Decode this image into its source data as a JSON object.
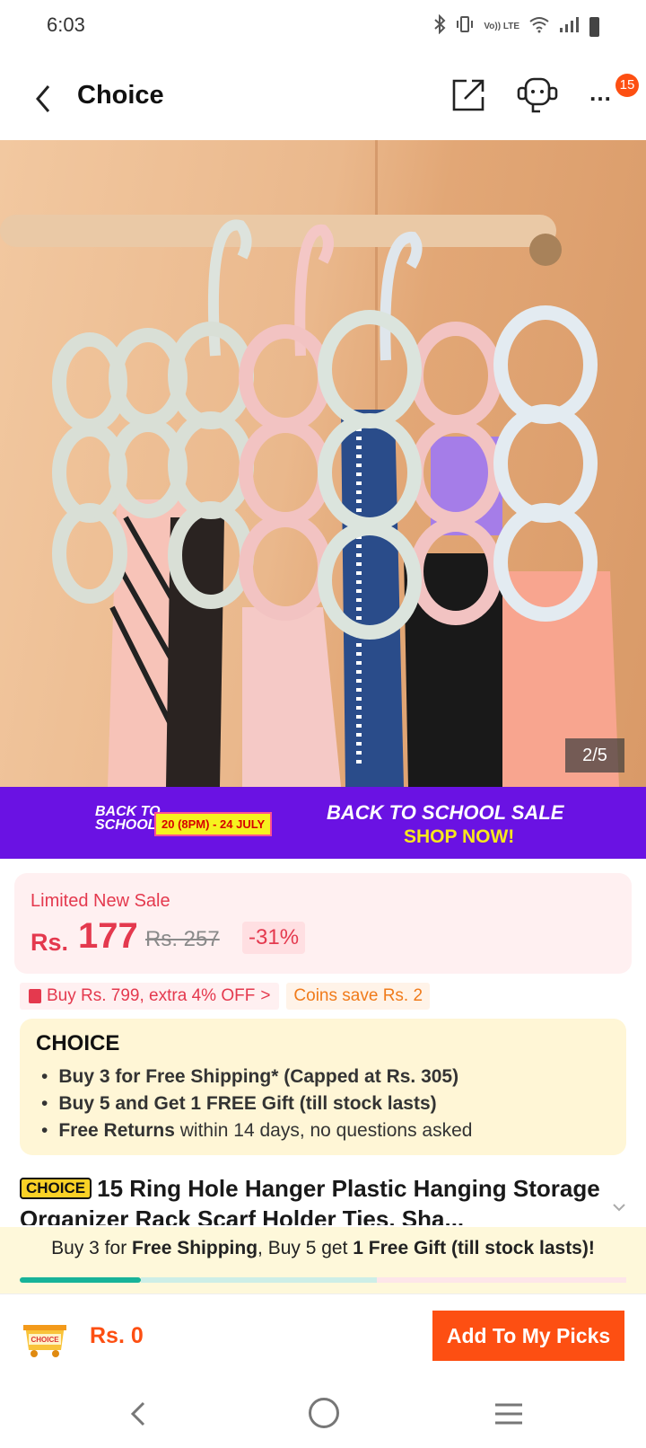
{
  "status_bar": {
    "time": "6:03",
    "icons": [
      "bluetooth-icon",
      "vibrate-icon",
      "volte-icon",
      "wifi-icon",
      "signal-icon",
      "battery-icon"
    ],
    "volte_label": "Vo)) LTE"
  },
  "header": {
    "title": "Choice",
    "more_badge": "15",
    "more_glyph": "…"
  },
  "gallery": {
    "counter": "2/5"
  },
  "promo": {
    "logo_line1": "BACK TO",
    "logo_line2": "SCHOOL",
    "dates": "20 (8PM) - 24 JULY",
    "title": "BACK TO SCHOOL SALE",
    "cta": "SHOP NOW!",
    "colors": {
      "background": "#6a12e3",
      "accent": "#f8e81c"
    }
  },
  "price": {
    "label": "Limited New Sale",
    "currency": "Rs.",
    "current": "177",
    "original": "Rs. 257",
    "discount": "-31%"
  },
  "coupons": {
    "coupon": "Buy Rs. 799, extra 4% OFF",
    "coupon_chevron": ">",
    "coins": "Coins save Rs. 2"
  },
  "choice": {
    "logo": "CHOICE",
    "items": [
      {
        "bold": "Buy 3 for  Free Shipping* (Capped at Rs. 305)",
        "rest": ""
      },
      {
        "bold": "Buy 5 and Get 1 FREE Gift (till stock lasts)",
        "rest": ""
      },
      {
        "bold": "Free Returns",
        "rest": " within 14 days, no questions asked"
      }
    ]
  },
  "product": {
    "badge": "CHOICE",
    "title": "15 Ring Hole Hanger Plastic Hanging Storage Organizer Rack Scarf Holder Ties, Sha..."
  },
  "bundle": {
    "t1": "Buy 3 for ",
    "t2": "Free Shipping",
    "t3": ", Buy 5 get ",
    "t4": "1 Free Gift (till stock lasts)!",
    "progress": 0.2
  },
  "actions": {
    "cart_label": "CHOICE",
    "total": "Rs. 0",
    "add_button": "Add To My Picks"
  },
  "colors": {
    "accent": "#fd4f12",
    "price_red": "#e4394e",
    "choice_yellow": "#f9d126",
    "progress_green": "#17b399"
  }
}
